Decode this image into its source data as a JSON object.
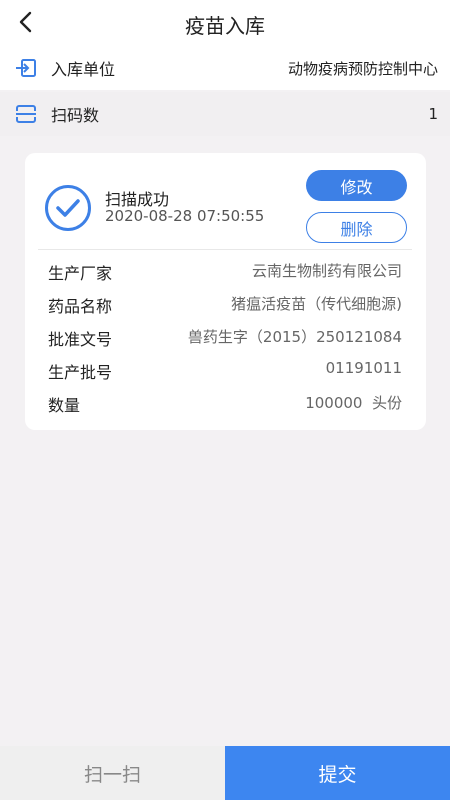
{
  "header": {
    "title": "疫苗入库"
  },
  "warehouse_unit": {
    "label": "入库单位",
    "value": "动物疫病预防控制中心"
  },
  "scan_count": {
    "label": "扫码数",
    "value": "1"
  },
  "record": {
    "status": "扫描成功",
    "time": "2020-08-28 07:50:55",
    "edit_label": "修改",
    "delete_label": "删除",
    "fields": [
      {
        "key": "生产厂家",
        "value": "云南生物制药有限公司"
      },
      {
        "key": "药品名称",
        "value": "猪瘟活疫苗（传代细胞源)"
      },
      {
        "key": "批准文号",
        "value": "兽药生字（2015）250121084"
      },
      {
        "key": "生产批号",
        "value": "01191011"
      },
      {
        "key": "数量",
        "value": "100000  头份"
      }
    ]
  },
  "footer": {
    "scan_label": "扫一扫",
    "submit_label": "提交"
  },
  "colors": {
    "accent": "#3d80e6",
    "submit_bg": "#3d86f0",
    "background": "#f3f1f3"
  }
}
